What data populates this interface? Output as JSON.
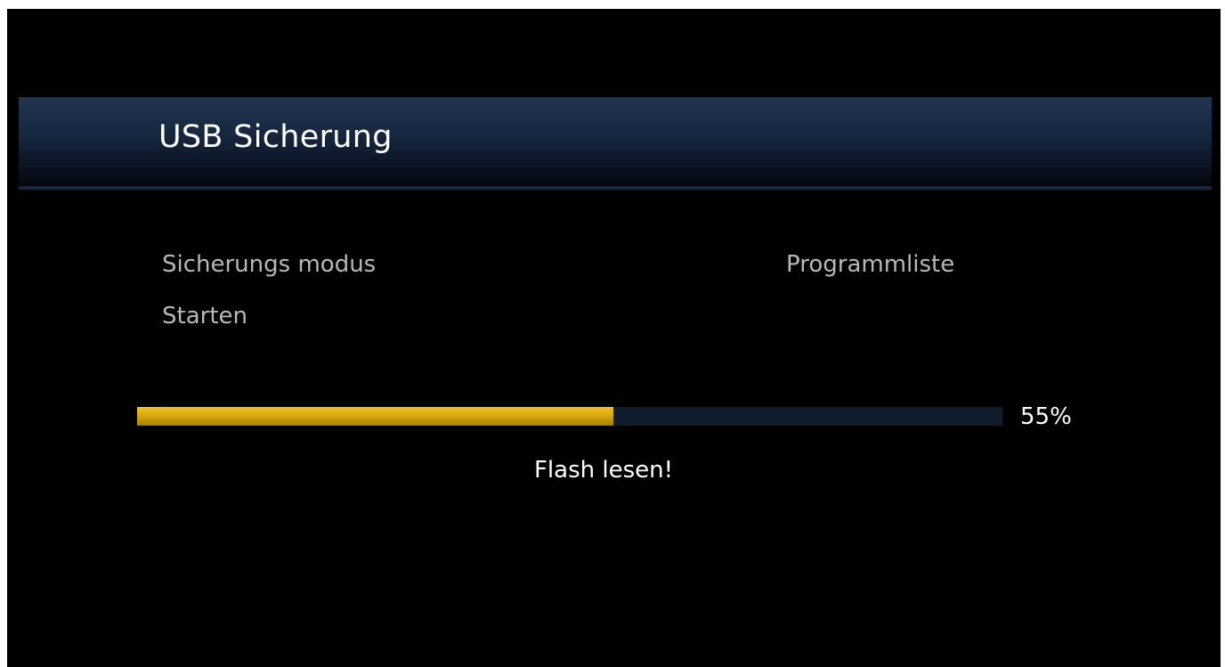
{
  "header": {
    "title": "USB Sicherung"
  },
  "settings": {
    "mode_label": "Sicherungs modus",
    "mode_value": "Programmliste",
    "start_label": "Starten"
  },
  "progress": {
    "percent": 55,
    "percent_label": "55%",
    "status": "Flash lesen!"
  },
  "colors": {
    "background": "#000000",
    "header_accent": "#1c2e48",
    "progress_fill": "#d9a90d",
    "progress_track": "#0f1c2b"
  }
}
